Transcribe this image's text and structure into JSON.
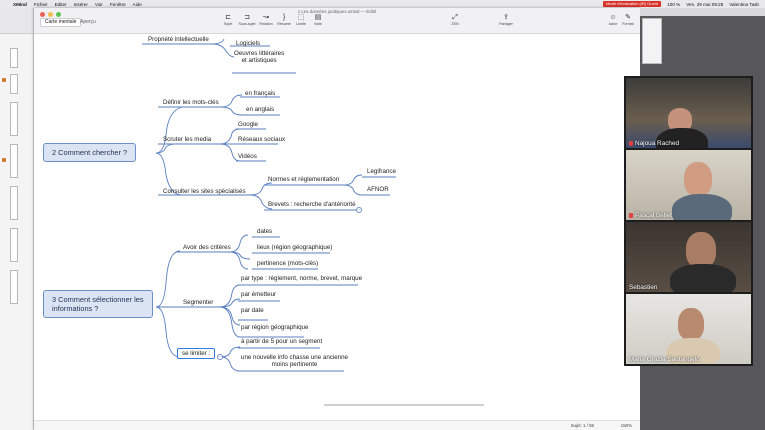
{
  "menubar": {
    "apple": "",
    "items": [
      "XMind",
      "Fichier",
      "Editer",
      "Insérer",
      "Voir",
      "Fenêtre",
      "Aide"
    ],
    "recording_badge": "Mode d'évaluation (IR) Ouvrir",
    "battery": "100 %",
    "clock": "Ven. 29 mai 09:28",
    "user": "Valentina Tasb"
  },
  "window": {
    "title": "1 Les données juridiques.xmind — Édité",
    "tabs": [
      {
        "label": "Carte mentale",
        "active": true
      },
      {
        "label": "Aperçu",
        "active": false
      }
    ],
    "toolbar": [
      {
        "label": "Sujet",
        "icon": "topic-icon",
        "glyph": "⊏"
      },
      {
        "label": "Sous-sujet",
        "icon": "subtopic-icon",
        "glyph": "⊐"
      },
      {
        "label": "Relation",
        "icon": "relation-icon",
        "glyph": "↝"
      },
      {
        "label": "Résumé",
        "icon": "summary-icon",
        "glyph": "}"
      },
      {
        "label": "Limite",
        "icon": "boundary-icon",
        "glyph": "⬚"
      },
      {
        "label": "Note",
        "icon": "note-icon",
        "glyph": "▤"
      },
      {
        "label": "ZEN",
        "icon": "zen-icon",
        "glyph": "⤢"
      },
      {
        "label": "Partager",
        "icon": "share-icon",
        "glyph": "⇪"
      },
      {
        "label": "Icône",
        "icon": "icon-panel-icon",
        "glyph": "☺"
      },
      {
        "label": "Format",
        "icon": "format-icon",
        "glyph": "✎"
      }
    ]
  },
  "mindmap": {
    "top_branch": {
      "label": "Propriété intellectuelle",
      "children": [
        "Logiciels",
        "Oeuvres littéraires\net artistiques"
      ]
    },
    "topic2": {
      "label": "2 Comment chercher ?",
      "branches": [
        {
          "label": "Définir les mots-clés",
          "children": [
            "en français",
            "en anglais"
          ]
        },
        {
          "label": "Scruter les media",
          "children": [
            "Google",
            "Réseaux sociaux",
            "Vidéos"
          ]
        },
        {
          "label": "Consulter les sites spécialisés",
          "children": [
            "Normes et réglementation",
            "Brevets : recherche d'antériorité"
          ],
          "grandchildren": [
            "Legifrance",
            "AFNOR"
          ]
        }
      ]
    },
    "topic3": {
      "label_line1": "3 Comment sélectionner les",
      "label_line2": "informations ?",
      "branches": [
        {
          "label": "Avoir des critères",
          "children": [
            "dates",
            "lieux (région géographique)",
            "pertinence (mots-clés)"
          ]
        },
        {
          "label": "Segmenter",
          "children": [
            "par type : règlement, norme, brevet, marque",
            "par émetteur",
            "par date",
            "par région géographique"
          ]
        },
        {
          "label": "se limiter :",
          "children": [
            "à partir de 5 pour un segment",
            "une nouvelle info chasse une ancienne\nmoins pertinente"
          ]
        }
      ]
    }
  },
  "statusbar": {
    "pages": "Sujet: 1 / 59",
    "zoom": "150%"
  },
  "participants": [
    {
      "name": "Najoua Rached",
      "muted": true
    },
    {
      "name": "Pascal Bellet",
      "muted": true
    },
    {
      "name": "Sebastien",
      "muted": false
    },
    {
      "name": "Maria Grazia Santangelo",
      "muted": false
    }
  ],
  "colors": {
    "topic_fill": "#dbe4f3",
    "topic_border": "#6d8fc7",
    "link": "#5b7fbf",
    "selection": "#2f7de1",
    "recording": "#d9342b"
  }
}
